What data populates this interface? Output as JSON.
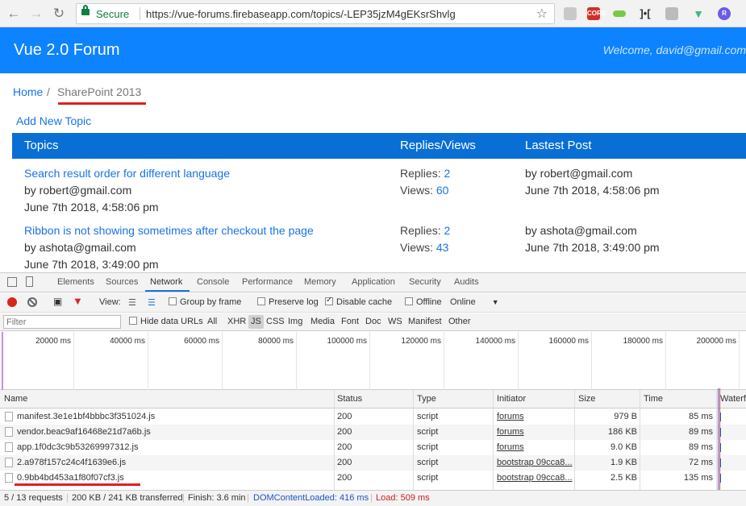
{
  "browser": {
    "secure_label": "Secure",
    "url": "https://vue-forums.firebaseapp.com/topics/-LEP35jzM4gEKsrShvlg",
    "cors_badge": "CORS",
    "ext_r": "R"
  },
  "app": {
    "brand": "Vue 2.0 Forum",
    "welcome": "Welcome, david@gmail.com"
  },
  "breadcrumb": {
    "home": "Home",
    "separator": "/",
    "current": "SharePoint 2013"
  },
  "add_topic": "Add New Topic",
  "topics_table": {
    "headers": {
      "topics": "Topics",
      "replies_views": "Replies/Views",
      "last_post": "Lastest Post"
    },
    "rows": [
      {
        "title": "Search result order for different language",
        "author": "by robert@gmail.com",
        "date": "June 7th 2018, 4:58:06 pm",
        "replies_label": "Replies:",
        "replies": "2",
        "views_label": "Views:",
        "views": "60",
        "last_by": "by robert@gmail.com",
        "last_date": "June 7th 2018, 4:58:06 pm"
      },
      {
        "title": "Ribbon is not showing sometimes after checkout the page",
        "author": "by ashota@gmail.com",
        "date": "June 7th 2018, 3:49:00 pm",
        "replies_label": "Replies:",
        "replies": "2",
        "views_label": "Views:",
        "views": "43",
        "last_by": "by ashota@gmail.com",
        "last_date": "June 7th 2018, 3:49:00 pm"
      }
    ]
  },
  "devtools": {
    "tabs": [
      "Elements",
      "Sources",
      "Network",
      "Console",
      "Performance",
      "Memory",
      "Application",
      "Security",
      "Audits"
    ],
    "active_tab": "Network",
    "toolbar": {
      "view_label": "View:",
      "group_by_frame": "Group by frame",
      "preserve_log": "Preserve log",
      "disable_cache": "Disable cache",
      "offline": "Offline",
      "throttle": "Online"
    },
    "filter": {
      "placeholder": "Filter",
      "hide_data_urls": "Hide data URLs",
      "types": [
        "All",
        "XHR",
        "JS",
        "CSS",
        "Img",
        "Media",
        "Font",
        "Doc",
        "WS",
        "Manifest",
        "Other"
      ],
      "active_type": "JS"
    },
    "timeline_ticks": [
      "20000 ms",
      "40000 ms",
      "60000 ms",
      "80000 ms",
      "100000 ms",
      "120000 ms",
      "140000 ms",
      "160000 ms",
      "180000 ms",
      "200000 ms"
    ],
    "columns": [
      "Name",
      "Status",
      "Type",
      "Initiator",
      "Size",
      "Time",
      "Waterfall"
    ],
    "requests": [
      {
        "name": "manifest.3e1e1bf4bbbc3f351024.js",
        "status": "200",
        "type": "script",
        "initiator": "forums",
        "size": "979 B",
        "time": "85 ms"
      },
      {
        "name": "vendor.beac9af16468e21d7a6b.js",
        "status": "200",
        "type": "script",
        "initiator": "forums",
        "size": "186 KB",
        "time": "89 ms"
      },
      {
        "name": "app.1f0dc3c9b53269997312.js",
        "status": "200",
        "type": "script",
        "initiator": "forums",
        "size": "9.0 KB",
        "time": "89 ms"
      },
      {
        "name": "2.a978f157c24c4f1639e6.js",
        "status": "200",
        "type": "script",
        "initiator": "bootstrap 09cca8...",
        "size": "1.9 KB",
        "time": "72 ms"
      },
      {
        "name": "0.9bb4bd453a1f80f07cf3.js",
        "status": "200",
        "type": "script",
        "initiator": "bootstrap 09cca8...",
        "size": "2.5 KB",
        "time": "135 ms"
      }
    ],
    "status": {
      "requests": "5 / 13 requests",
      "transferred": "200 KB / 241 KB transferred",
      "finish": "Finish: 3.6 min",
      "dom_content_loaded": "DOMContentLoaded: 416 ms",
      "load": "Load: 509 ms"
    }
  },
  "colors": {
    "header_bg": "#0d83ff",
    "table_header_bg": "#0a6fd4",
    "link": "#1a73e8",
    "highlight_underline": "#e02020"
  }
}
